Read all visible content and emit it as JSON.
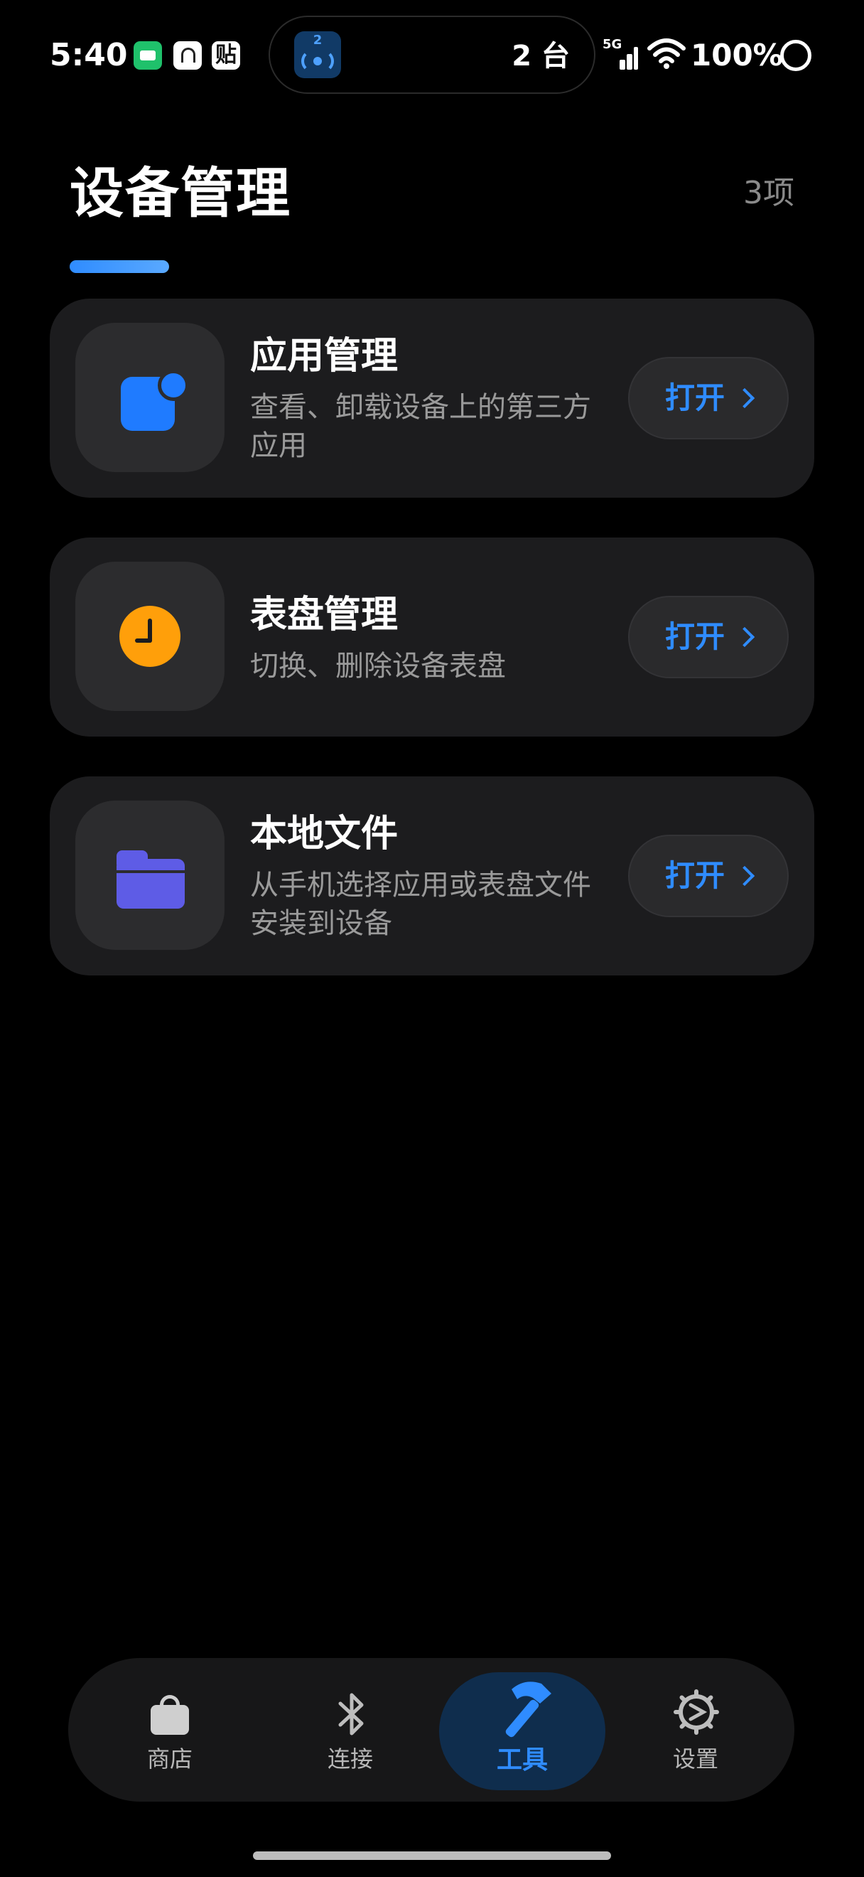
{
  "status_bar": {
    "time": "5:40",
    "notif_icons": [
      "battery-saver-icon",
      "link-icon",
      "paste-icon"
    ],
    "paste_glyph": "贴",
    "island_badge": "2",
    "island_text": "2 台",
    "network": "5G",
    "battery": "100%"
  },
  "header": {
    "title": "设备管理",
    "count": "3项",
    "accent_color": "#2f8cff"
  },
  "cards": [
    {
      "title": "应用管理",
      "desc": "查看、卸载设备上的第三方应用",
      "button": "打开",
      "icon": "app-icon",
      "icon_color": "#1f7bff"
    },
    {
      "title": "表盘管理",
      "desc": "切换、删除设备表盘",
      "button": "打开",
      "icon": "clock-icon",
      "icon_color": "#ff9f0a"
    },
    {
      "title": "本地文件",
      "desc": "从手机选择应用或表盘文件安装到设备",
      "button": "打开",
      "icon": "folder-icon",
      "icon_color": "#5e5ce6"
    }
  ],
  "bottom_nav": {
    "items": [
      {
        "label": "商店",
        "icon": "shopping-bag-icon",
        "active": false
      },
      {
        "label": "连接",
        "icon": "bluetooth-icon",
        "active": false
      },
      {
        "label": "工具",
        "icon": "hammer-icon",
        "active": true
      },
      {
        "label": "设置",
        "icon": "gear-icon",
        "active": false
      }
    ]
  }
}
